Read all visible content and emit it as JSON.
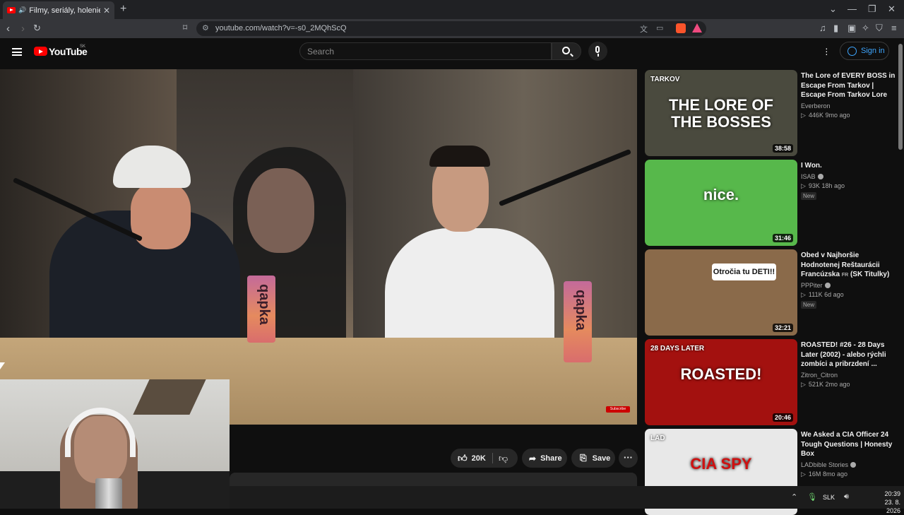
{
  "browser": {
    "tab_title": "Filmy, seriály, holenie a cesto",
    "new_tab_symbol": "+",
    "url": "youtube.com/watch?v=-s0_2MQhScQ"
  },
  "youtube": {
    "logo_text": "YouTube",
    "country_code": "SK",
    "search_placeholder": "Search",
    "sign_in": "Sign in"
  },
  "video": {
    "can_text": "qapka",
    "watermark": "Subscribe",
    "likes": "20K",
    "share_label": "Share",
    "save_label": "Save"
  },
  "recommendations": [
    {
      "title": "The Lore of EVERY BOSS in Escape From Tarkov | Escape From Tarkov Lore",
      "channel": "Everberon",
      "verified": false,
      "views": "446K",
      "age": "9mo ago",
      "duration": "38:58",
      "badge": "",
      "thumb_text": "THE LORE OF THE BOSSES",
      "thumb_sub": "TARKOV",
      "thumb_color": "#4a4a3e"
    },
    {
      "title": "I Won.",
      "channel": "ISAB",
      "verified": true,
      "views": "93K",
      "age": "18h ago",
      "duration": "31:46",
      "badge": "New",
      "thumb_text": "nice.",
      "thumb_sub": "",
      "thumb_color": "#57b84b"
    },
    {
      "title": "Obed v Najhoršie Hodnotenej Reštaurácii Francúzska",
      "title_suffix": "FR",
      "title_tail": "(SK Titulky)",
      "channel": "PPPiter",
      "verified": true,
      "views": "111K",
      "age": "6d ago",
      "duration": "32:21",
      "badge": "New",
      "thumb_text": "Otročia tu DETI!!",
      "thumb_sub": "",
      "thumb_color": "#8a6a4a"
    },
    {
      "title": "ROASTED! #26 - 28 Days Later (2002) - alebo rýchli zombíci a pribrzdení ...",
      "channel": "Zitron_Citron",
      "verified": false,
      "views": "521K",
      "age": "2mo ago",
      "duration": "20:46",
      "badge": "",
      "thumb_text": "ROASTED!",
      "thumb_sub": "28 DAYS LATER",
      "thumb_color": "#a3110f"
    },
    {
      "title": "We Asked a CIA Officer 24 Tough Questions | Honesty Box",
      "channel": "LADbible Stories",
      "verified": true,
      "views": "16M",
      "age": "8mo ago",
      "duration": "",
      "badge": "",
      "thumb_text": "CIA SPY",
      "thumb_sub": "LAD",
      "thumb_color": "#e8e8e8"
    }
  ],
  "taskbar": {
    "lang": "SLK",
    "time": "20:39",
    "date": "23. 8. 2026"
  },
  "colors": {
    "accent": "#3ea6ff",
    "youtube_red": "#ff0000",
    "background": "#0f0f0f"
  }
}
